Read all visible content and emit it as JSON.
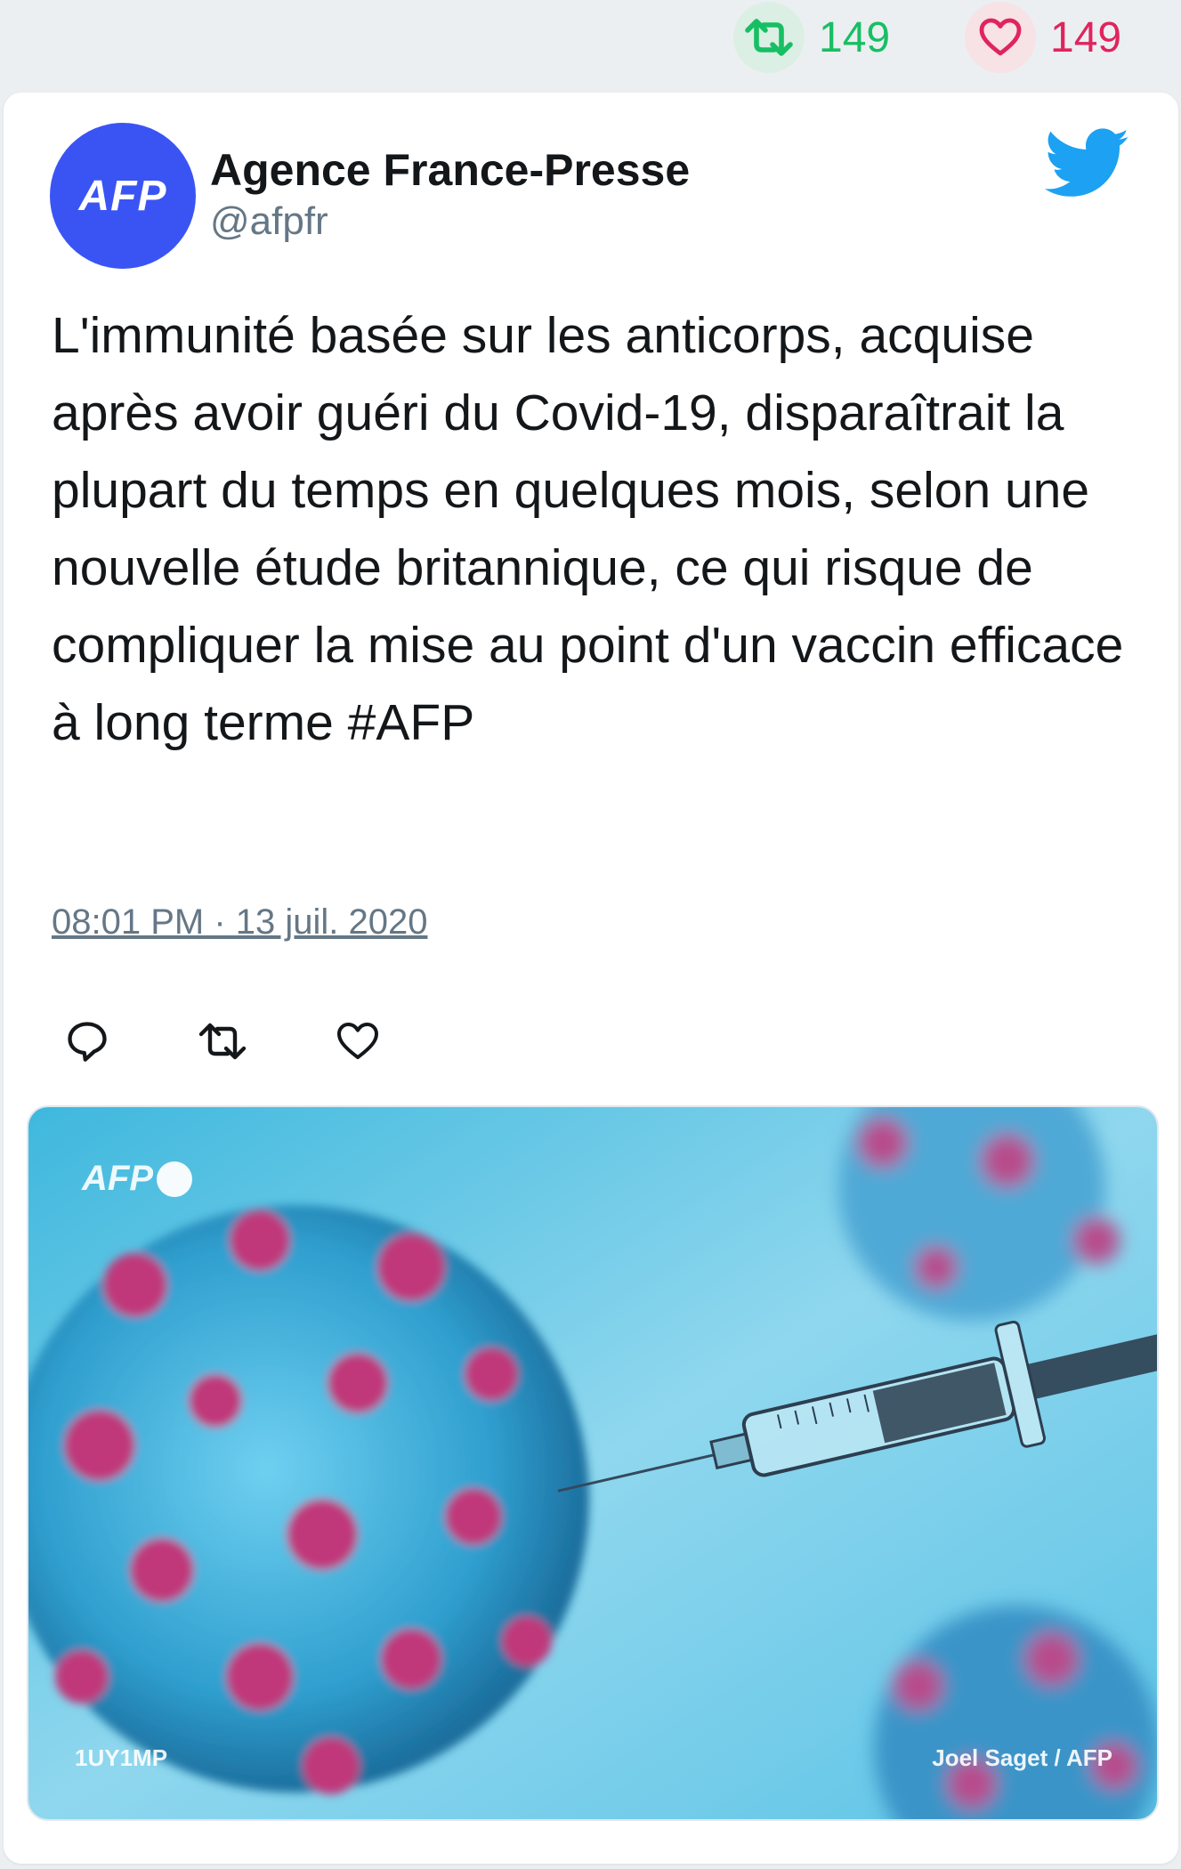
{
  "stats": {
    "retweets": "149",
    "likes": "149"
  },
  "author": {
    "avatar_text": "AFP",
    "name": "Agence France-Presse",
    "handle": "@afpfr"
  },
  "tweet": {
    "text": "L'immunité basée sur les anticorps, acquise après avoir guéri du Covid-19, disparaîtrait la plupart du temps en quelques mois, selon une nouvelle étude britannique, ce qui risque de compliquer la mise au point d'un vaccin efficace à long terme #AFP",
    "timestamp": "08:01 PM · 13 juil. 2020"
  },
  "media": {
    "watermark": "AFP",
    "code": "1UY1MP",
    "credit": "Joel Saget / AFP"
  },
  "colors": {
    "twitter_blue": "#1da1f2",
    "retweet_green": "#17bf63",
    "like_red": "#e0245e",
    "avatar_blue": "#3a54f4"
  },
  "icons": {
    "retweet": "retweet-icon",
    "like": "heart-icon",
    "reply": "reply-icon",
    "logo": "twitter-bird-icon"
  }
}
